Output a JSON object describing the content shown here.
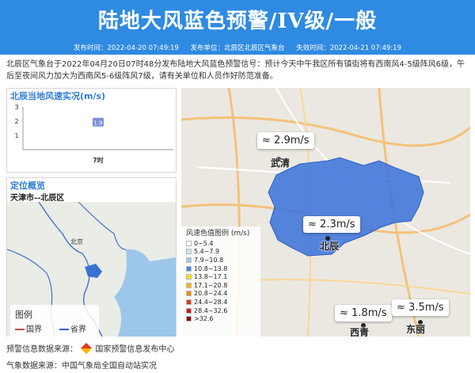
{
  "header": {
    "title": "陆地大风蓝色预警/IV级/一般",
    "publish_time": "发布时间：2022-04-20 07:49:19",
    "publisher": "发布单位：北辰区北辰区气象台",
    "expire_time": "失效时间：2022-04-21 07:49:19"
  },
  "description": "北辰区气象台于2022年04月20日07时48分发布陆地大风蓝色预警信号：预计今天中午我区所有镇街将有西南风4-5级阵风6级，午后至夜间风力加大为西南风5-6级阵风7级，请有关单位和人员作好防范准备。",
  "wind_panel": {
    "title": "北辰当地风速实况(m/s)",
    "chart_data": {
      "type": "bar",
      "categories": [
        "7时"
      ],
      "values": [
        1.9
      ],
      "title": "北辰当地风速实况(m/s)",
      "yticks": [
        "1",
        "2",
        "3"
      ],
      "ylim": [
        0,
        3
      ]
    },
    "label": "1.9"
  },
  "location_panel": {
    "title": "定位概览",
    "place": "天津市--北辰区",
    "legend_title": "图例",
    "legend_items": [
      "国界",
      "省界"
    ],
    "city_label": "北京"
  },
  "map": {
    "legend_title": "风速色值图例 (m/s)",
    "legend_items": [
      {
        "label": "0~5.4",
        "color": "#ffffff"
      },
      {
        "label": "5.4~7.9",
        "color": "#cfe6f7"
      },
      {
        "label": "7.9~10.8",
        "color": "#9fc8ee"
      },
      {
        "label": "10.8~13.8",
        "color": "#4d82e3"
      },
      {
        "label": "13.8~17.1",
        "color": "#f5e300"
      },
      {
        "label": "17.1~20.8",
        "color": "#f5b800"
      },
      {
        "label": "20.8~24.4",
        "color": "#f08a00"
      },
      {
        "label": "24.4~28.4",
        "color": "#e8331a"
      },
      {
        "label": "28.4~32.6",
        "color": "#cc1a10"
      },
      {
        "label": ">32.6",
        "color": "#8a0a0a"
      }
    ],
    "stations": [
      {
        "place": "武清",
        "wind": "2.9m/s"
      },
      {
        "place": "北辰",
        "wind": "2.3m/s"
      },
      {
        "place": "西青",
        "wind": "1.8m/s"
      },
      {
        "place": "东丽",
        "wind": "3.5m/s"
      }
    ],
    "wind_icon": "≈"
  },
  "footer": {
    "warning_source": "预警信息数据来源：",
    "warning_source_name": "国家预警信息发布中心",
    "weather_source": "气象数据来源：中国气象局全国自动站实况"
  }
}
